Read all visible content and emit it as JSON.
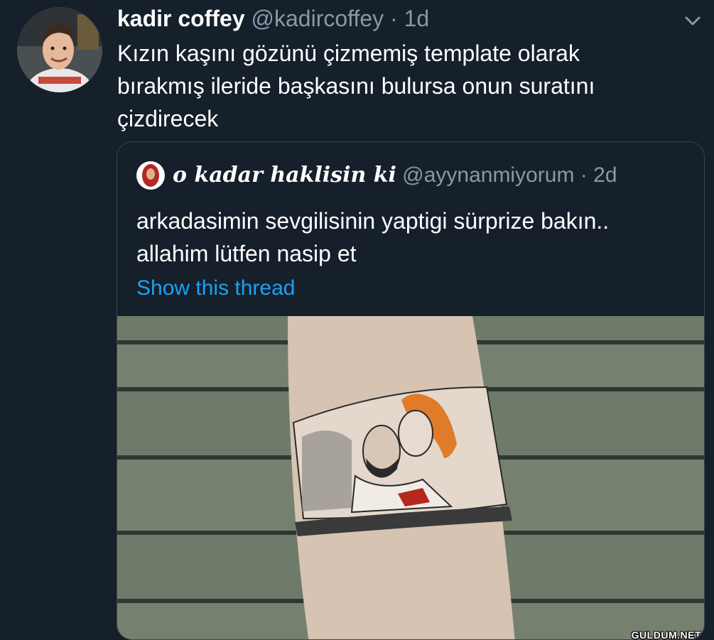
{
  "tweet": {
    "display_name": "kadir coffey",
    "handle": "@kadircoffey",
    "separator": "·",
    "time": "1d",
    "text": "Kızın kaşını gözünü çizmemiş template olarak bırakmış ileride başkasını bulursa onun suratını çizdirecek",
    "menu_icon": "chevron-down-icon"
  },
  "quoted": {
    "display_name": "o kadar haklisin ki",
    "handle": "@ayynanmiyorum",
    "separator": "·",
    "time": "2d",
    "text_line1": "arkadasimin sevgilisinin yaptigi sürprize bakın..",
    "text_line2": "allahim lütfen nasip et",
    "thread_link": "Show this thread"
  },
  "media": {
    "description_icon": "photo",
    "watermark": "GULDUM.NET"
  },
  "colors": {
    "background": "#15202b",
    "secondary_text": "#8899a6",
    "link": "#1da1f2",
    "border": "#38444d"
  }
}
